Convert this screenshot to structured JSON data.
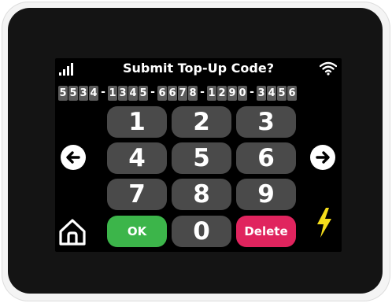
{
  "screen": {
    "title": "Submit Top-Up Code?",
    "code_groups": [
      "5534",
      "1345",
      "6678",
      "1290",
      "3456"
    ],
    "code_separator": "-",
    "keypad": {
      "rows": [
        [
          "1",
          "2",
          "3"
        ],
        [
          "4",
          "5",
          "6"
        ],
        [
          "7",
          "8",
          "9"
        ]
      ],
      "ok_label": "OK",
      "zero_label": "0",
      "delete_label": "Delete"
    },
    "icons": {
      "signal": "signal-strength-icon",
      "wifi": "wifi-icon",
      "left": "arrow-left-icon",
      "right": "arrow-right-icon",
      "home": "home-icon",
      "power": "lightning-bolt-icon"
    },
    "colors": {
      "background": "#000000",
      "key": "#4a4a4a",
      "ok": "#3cb54a",
      "delete": "#e0245e",
      "code_digit_bg": "#5b5b5b",
      "bolt": "#f5dd1b"
    }
  }
}
